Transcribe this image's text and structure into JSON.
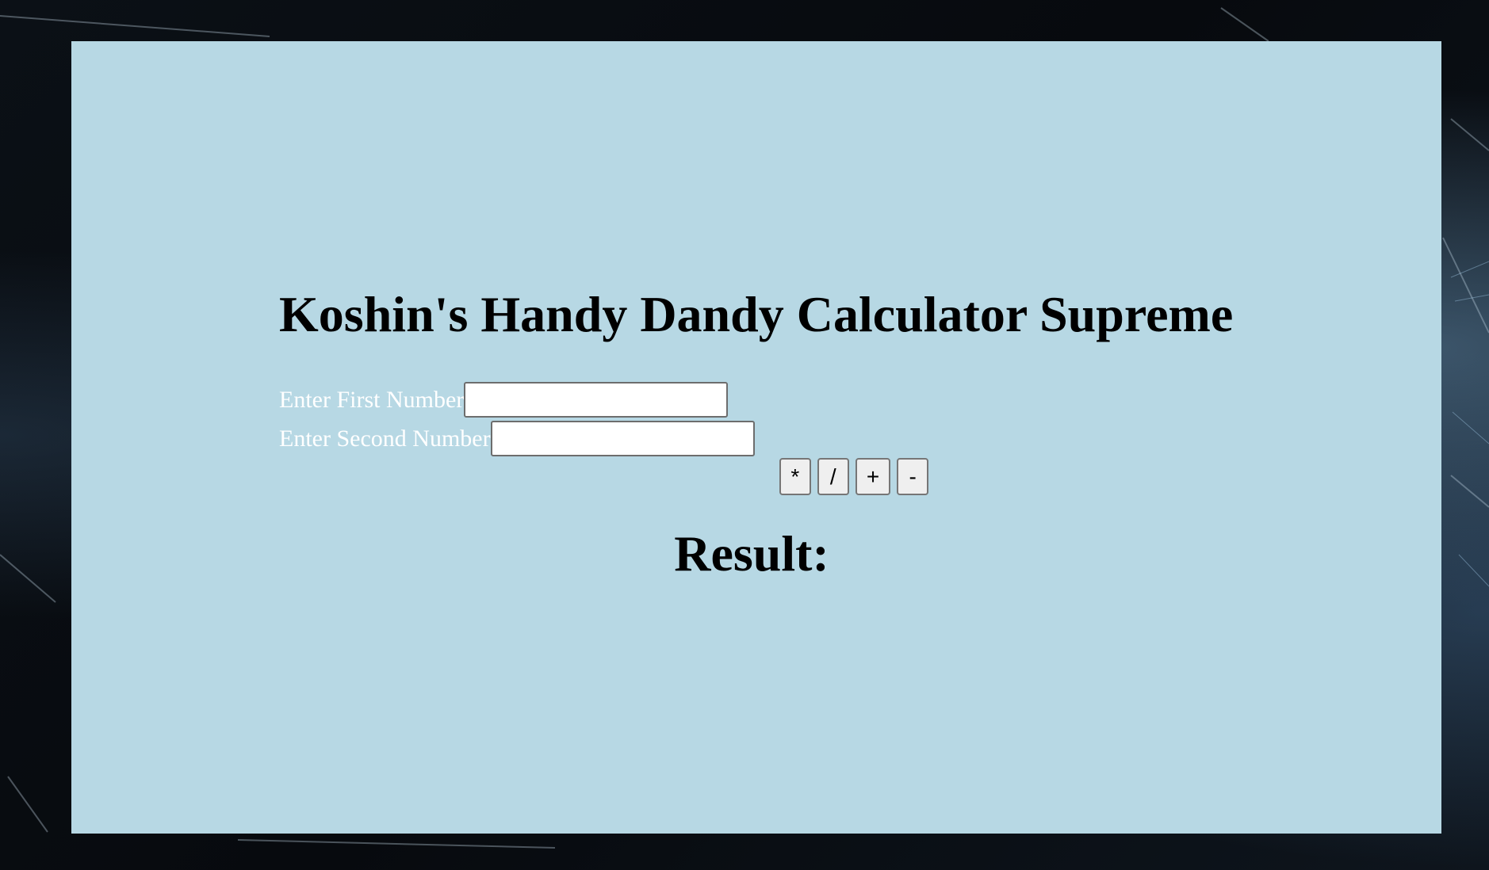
{
  "page": {
    "title": "Koshin's Handy Dandy Calculator Supreme"
  },
  "form": {
    "first_label": "Enter First Number",
    "first_value": "",
    "second_label": "Enter Second Number",
    "second_value": ""
  },
  "operations": {
    "multiply": "*",
    "divide": "/",
    "add": "+",
    "subtract": "-"
  },
  "result": {
    "label": "Result:"
  },
  "colors": {
    "panel_background": "#b7d8e4",
    "label_text": "#ffffff",
    "heading_text": "#000000"
  }
}
